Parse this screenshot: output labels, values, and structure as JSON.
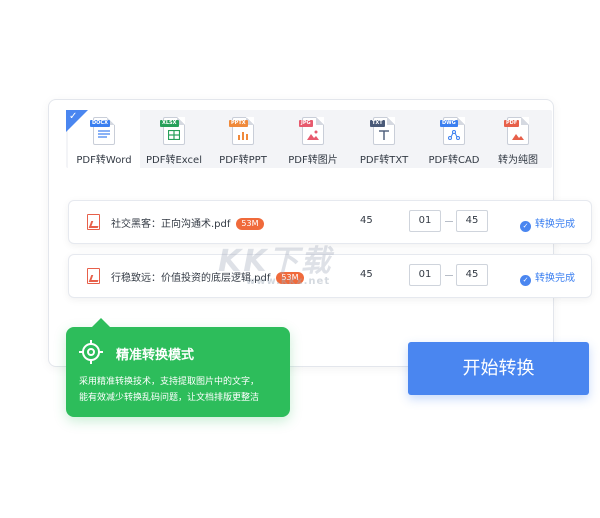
{
  "tabs": [
    {
      "label": "PDF转Word",
      "tag": "DOCX",
      "tag_color": "#3b7ff0",
      "icon": "word-file-icon",
      "active": true
    },
    {
      "label": "PDF转Excel",
      "tag": "XLSX",
      "tag_color": "#27a05a",
      "icon": "excel-file-icon",
      "active": false
    },
    {
      "label": "PDF转PPT",
      "tag": "PPTX",
      "tag_color": "#f08a3b",
      "icon": "ppt-file-icon",
      "active": false
    },
    {
      "label": "PDF转图片",
      "tag": "JPG",
      "tag_color": "#e75a6e",
      "icon": "image-file-icon",
      "active": false
    },
    {
      "label": "PDF转TXT",
      "tag": "TXT",
      "tag_color": "#4a5a78",
      "icon": "txt-file-icon",
      "active": false
    },
    {
      "label": "PDF转CAD",
      "tag": "DWG",
      "tag_color": "#3b7ff0",
      "icon": "cad-file-icon",
      "active": false
    },
    {
      "label": "转为纯图",
      "tag": "PDF",
      "tag_color": "#e7604a",
      "icon": "pure-image-file-icon",
      "active": false
    }
  ],
  "files": [
    {
      "name": "社交黑客：正向沟通术.pdf",
      "size": "53M",
      "pages": "45",
      "from": "01",
      "to": "45",
      "status": "转换完成"
    },
    {
      "name": "行稳致远：价值投资的底层逻辑.pdf",
      "size": "53M",
      "pages": "45",
      "from": "01",
      "to": "45",
      "status": "转换完成"
    }
  ],
  "tip": {
    "title": "精准转换模式",
    "lines": [
      "采用精准转换技术，支持提取图片中的文字，",
      "能有效减少转换乱码问题，让文档排版更整洁"
    ]
  },
  "start_button": "开始转换",
  "watermark": {
    "text": "KK下载",
    "url": "www.kkx.net"
  },
  "colors": {
    "accent": "#4a86f0",
    "tip_green": "#2dbd5b",
    "size_badge": "#f06a3b",
    "pdf_red": "#e7604a"
  }
}
